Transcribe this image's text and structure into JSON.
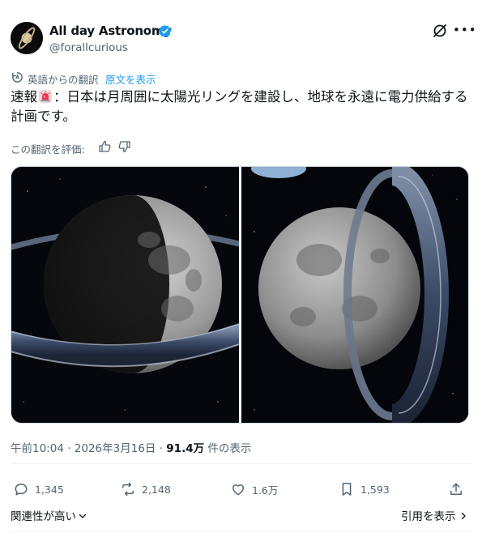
{
  "author": {
    "name": "All day Astronomy",
    "handle": "@forallcurious",
    "verified": true,
    "avatar_icon": "saturn-avatar-icon"
  },
  "header_icons": [
    "grok-icon",
    "more-icon"
  ],
  "translation": {
    "label": "英語からの翻訳",
    "show_original": "原文を表示"
  },
  "tweet": {
    "text_before": "速報",
    "emoji": "siren-emoji",
    "text_after": "：日本は月周囲に太陽光リングを建設し、地球を永遠に電力供給する計画です。"
  },
  "rate": {
    "label": "この翻訳を評価:"
  },
  "media": {
    "images": [
      "moon-solar-ring-left",
      "moon-solar-ring-right"
    ]
  },
  "meta": {
    "time": "午前10:04",
    "sep1": " · ",
    "date": "2026年3月16日",
    "sep2": " · ",
    "views": "91.4万",
    "views_suffix": " 件の表示"
  },
  "actions": {
    "replies": "1,345",
    "reposts": "2,148",
    "likes": "1.6万",
    "bookmarks": "1,593"
  },
  "footer": {
    "relevance": "関連性が高い",
    "quotes": "引用を表示"
  },
  "colors": {
    "text": "#0f1419",
    "secondary": "#536471",
    "link": "#1d9bf0",
    "divider": "#eff3f4"
  }
}
